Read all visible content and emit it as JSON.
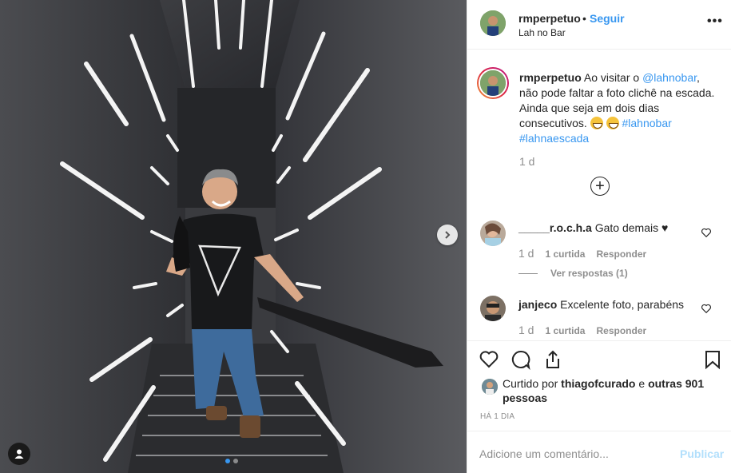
{
  "post": {
    "username": "rmperpetuo",
    "separator": "•",
    "follow_label": "Seguir",
    "location": "Lah no Bar",
    "more_label": "•••"
  },
  "caption": {
    "username": "rmperpetuo",
    "text_a": "Ao visitar o",
    "mention": "@lahnobar",
    "text_b": ", não pode faltar a foto clichê na escada. Ainda que seja em dois dias consecutivos.",
    "hashtag1": "#lahnobar",
    "hashtag2": "#lahnaescada",
    "time": "1 d",
    "expand_label": "+"
  },
  "comments": [
    {
      "username": "_____r.o.c.h.a",
      "text": "Gato demais ♥",
      "time": "1 d",
      "likes": "1 curtida",
      "reply": "Responder"
    },
    {
      "username": "janjeco",
      "text": "Excelente foto, parabéns",
      "time": "1 d",
      "likes": "1 curtida",
      "reply": "Responder"
    }
  ],
  "view_replies": "Ver respostas (1)",
  "likes": {
    "prefix": "Curtido por",
    "user": "thiagofcurado",
    "middle": "e",
    "others": "outras 901 pessoas"
  },
  "posted_ago": "HÁ 1 DIA",
  "comment_box": {
    "placeholder": "Adicione um comentário...",
    "publish": "Publicar"
  },
  "carousel": {
    "slides": 2,
    "current": 1
  },
  "colors": {
    "link": "#3897f0",
    "muted": "#8e8e8e",
    "publish_disabled": "#b2dffc"
  }
}
